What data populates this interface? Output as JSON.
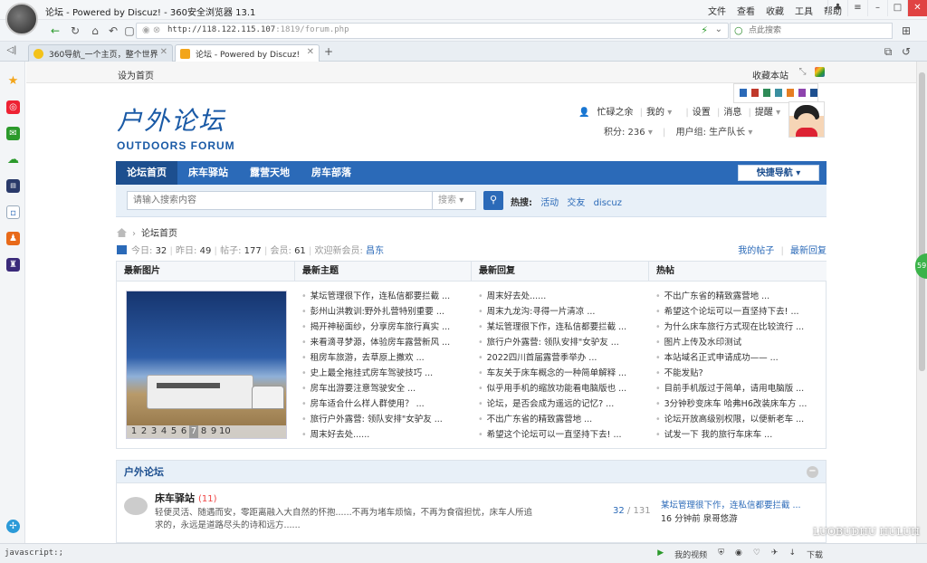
{
  "browser": {
    "title": "论坛 - Powered by Discuz! - 360安全浏览器 13.1",
    "menus": [
      "文件",
      "查看",
      "收藏",
      "工具",
      "帮助"
    ],
    "url_host": "http://118.122.115.107",
    "url_rest": ":1819/forum.php",
    "search_placeholder": "点此搜索",
    "tabs": [
      {
        "label": "360导航_一个主页，整个世界"
      },
      {
        "label": "论坛 - Powered by Discuz!"
      }
    ],
    "status_left": "javascript:;",
    "status_items": [
      "我的视频",
      "下载"
    ],
    "watermark": "LUOBUDHU HULUH"
  },
  "page": {
    "set_home": "设为首页",
    "favorite": "收藏本站",
    "swatch_colors": [
      "#2b6ab8",
      "#c0392b",
      "#2e8b57",
      "#3a8fa0",
      "#e67e22",
      "#8e44ad",
      "#1d4f8f"
    ],
    "logo_cn": "户外论坛",
    "logo_en": "OUTDOORS FORUM",
    "user": {
      "name": "忙碌之余",
      "my": "我的",
      "settings": "设置",
      "messages": "消息",
      "remind": "提醒",
      "logout": "退出",
      "points": "积分: 236",
      "group": "用户组: 生产队长"
    },
    "nav": [
      "论坛首页",
      "床车驿站",
      "露营天地",
      "房车部落"
    ],
    "quick_nav": "快捷导航",
    "search": {
      "placeholder": "请输入搜索内容",
      "type": "搜索",
      "hot_label": "热搜:",
      "hot": [
        "活动",
        "交友",
        "discuz"
      ]
    },
    "breadcrumb": "论坛首页",
    "stats": {
      "today_label": "今日:",
      "today": "32",
      "yesterday_label": "昨日:",
      "yesterday": "49",
      "posts_label": "帖子:",
      "posts": "177",
      "members_label": "会员:",
      "members": "61",
      "welcome_label": "欢迎新会员:",
      "new_member": "昌东"
    },
    "my_posts": "我的帖子",
    "latest_reply": "最新回复",
    "sections": {
      "photos": "最新图片",
      "topics": "最新主题",
      "replies": "最新回复",
      "hot": "热帖"
    },
    "photo_pager": [
      "1",
      "2",
      "3",
      "4",
      "5",
      "6",
      "7",
      "8",
      "9",
      "10"
    ],
    "topics": [
      "某坛管理很下作，连私信都要拦截 ...",
      "彭州山洪教训:野外扎营特别重要 ...",
      "揭开神秘面纱，分享房车旅行真实 ...",
      "来看滴寻梦源，体验房车露营新风 ...",
      "租房车旅游，去草原上撒欢 ...",
      "史上最全拖挂式房车驾驶技巧 ...",
      "房车出游要注意驾驶安全 ...",
      "房车适合什么样人群使用？ ...",
      "旅行户外露营: 领队安排\"女驴友 ...",
      "周末好去处......"
    ],
    "replies": [
      "周末好去处......",
      "周末九龙沟:寻得一片清凉 ...",
      "某坛管理很下作，连私信都要拦截 ...",
      "旅行户外露营: 领队安排\"女驴友 ...",
      "2022四川首届露营季举办 ...",
      "车友关于床车概念的一种简单解释 ...",
      "似乎用手机的缩放功能看电脑版也 ...",
      "论坛，是否会成为遥远的记忆? ...",
      "不出广东省的精致露营地 ...",
      "希望这个论坛可以一直坚持下去! ..."
    ],
    "hot": [
      "不出广东省的精致露营地 ...",
      "希望这个论坛可以一直坚持下去! ...",
      "为什么床车旅行方式现在比较流行 ...",
      "图片上传及水印测试",
      "本站域名正式申请成功—— ...",
      "不能发贴?",
      "目前手机版过于简单，请用电脑版 ...",
      "3分钟秒变床车 哈弗H6改装床车方 ...",
      "论坛开放高级别权限，以便新老车 ...",
      "试发一下 我的旅行车床车 ..."
    ],
    "forum": {
      "section_title": "户外论坛",
      "name": "床车驿站",
      "count": "(11)",
      "desc": "轻便灵活、随遇而安，零距离融入大自然的怀抱......不再为堵车烦恼，不再为食宿担忧，床车人所追求的，永远是道路尽头的诗和远方......",
      "threads": "32",
      "posts": "131",
      "last_title": "某坛管理很下作，连私信都要拦截 ...",
      "last_time": "16 分钟前 泉哥悠游"
    }
  }
}
